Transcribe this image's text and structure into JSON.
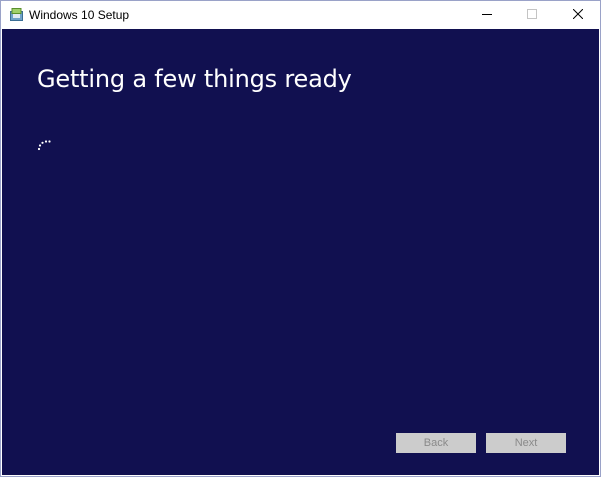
{
  "window": {
    "title": "Windows 10 Setup",
    "app_icon": "setup-disc-icon",
    "controls": {
      "minimize_icon": "minimize-icon",
      "maximize_icon": "maximize-icon",
      "close_icon": "close-icon"
    }
  },
  "main": {
    "heading": "Getting a few things ready",
    "spinner_icon": "loading-spinner-icon"
  },
  "footer": {
    "back_label": "Back",
    "next_label": "Next"
  },
  "colors": {
    "background": "#111050",
    "text": "#ffffff",
    "button_disabled_bg": "#cccccc",
    "button_disabled_text": "#8a8a8a"
  }
}
